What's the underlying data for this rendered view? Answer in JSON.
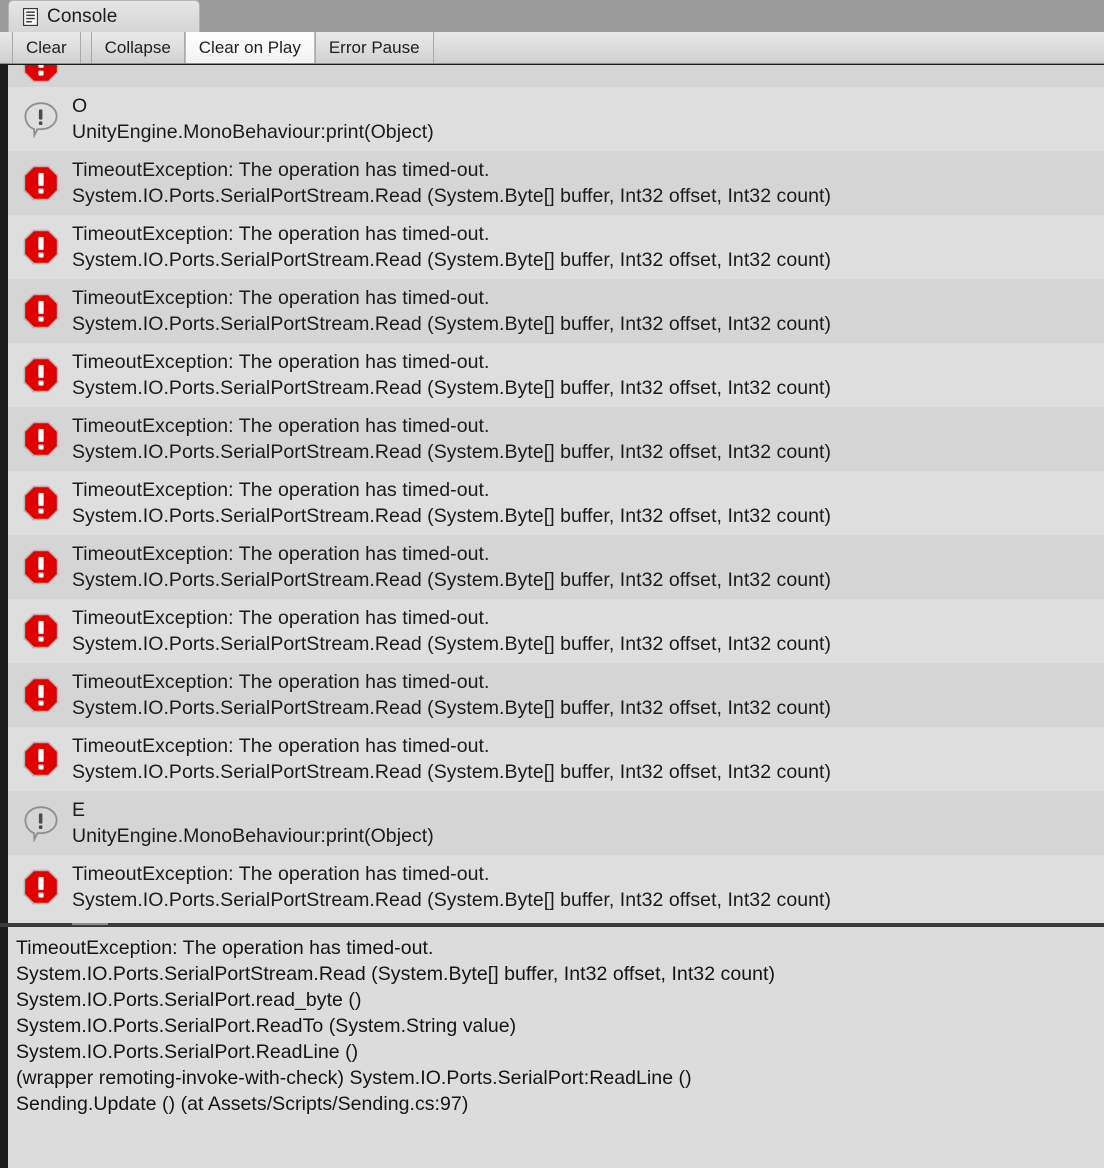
{
  "window": {
    "tab_label": "Console",
    "tab_icon": "console-document-icon"
  },
  "toolbar": {
    "buttons": [
      {
        "label": "Clear",
        "name": "clear-button",
        "active": false
      },
      {
        "label": "Collapse",
        "name": "collapse-button",
        "active": false
      },
      {
        "label": "Clear on Play",
        "name": "clear-on-play-button",
        "active": true
      },
      {
        "label": "Error Pause",
        "name": "error-pause-button",
        "active": false
      }
    ]
  },
  "colors": {
    "error_red": "#e00000",
    "header_gray": "#9b9b9b",
    "row_light": "#dedede",
    "row_dark": "#d5d5d5",
    "text": "#1b1b1b",
    "splitter": "#3b3b3b"
  },
  "log": {
    "error_message": "TimeoutException: The operation has timed-out.",
    "error_stack_line": "System.IO.Ports.SerialPortStream.Read (System.Byte[] buffer, Int32 offset, Int32 count)",
    "print_stack_line": "UnityEngine.MonoBehaviour:print(Object)",
    "entries": [
      {
        "type": "error",
        "clipped": true,
        "icon": "error-octagon-icon",
        "line1": "TimeoutException: The operation has timed-out.",
        "line2": "System.IO.Ports.SerialPortStream.Read (System.Byte[] buffer, Int32 offset, Int32 count)"
      },
      {
        "type": "log",
        "icon": "log-bubble-icon",
        "line1": "O",
        "line2": "UnityEngine.MonoBehaviour:print(Object)"
      },
      {
        "type": "error",
        "icon": "error-octagon-icon",
        "line1": "TimeoutException: The operation has timed-out.",
        "line2": "System.IO.Ports.SerialPortStream.Read (System.Byte[] buffer, Int32 offset, Int32 count)"
      },
      {
        "type": "error",
        "icon": "error-octagon-icon",
        "line1": "TimeoutException: The operation has timed-out.",
        "line2": "System.IO.Ports.SerialPortStream.Read (System.Byte[] buffer, Int32 offset, Int32 count)"
      },
      {
        "type": "error",
        "icon": "error-octagon-icon",
        "line1": "TimeoutException: The operation has timed-out.",
        "line2": "System.IO.Ports.SerialPortStream.Read (System.Byte[] buffer, Int32 offset, Int32 count)"
      },
      {
        "type": "error",
        "icon": "error-octagon-icon",
        "line1": "TimeoutException: The operation has timed-out.",
        "line2": "System.IO.Ports.SerialPortStream.Read (System.Byte[] buffer, Int32 offset, Int32 count)"
      },
      {
        "type": "error",
        "icon": "error-octagon-icon",
        "line1": "TimeoutException: The operation has timed-out.",
        "line2": "System.IO.Ports.SerialPortStream.Read (System.Byte[] buffer, Int32 offset, Int32 count)"
      },
      {
        "type": "error",
        "icon": "error-octagon-icon",
        "line1": "TimeoutException: The operation has timed-out.",
        "line2": "System.IO.Ports.SerialPortStream.Read (System.Byte[] buffer, Int32 offset, Int32 count)"
      },
      {
        "type": "error",
        "icon": "error-octagon-icon",
        "line1": "TimeoutException: The operation has timed-out.",
        "line2": "System.IO.Ports.SerialPortStream.Read (System.Byte[] buffer, Int32 offset, Int32 count)"
      },
      {
        "type": "error",
        "icon": "error-octagon-icon",
        "line1": "TimeoutException: The operation has timed-out.",
        "line2": "System.IO.Ports.SerialPortStream.Read (System.Byte[] buffer, Int32 offset, Int32 count)"
      },
      {
        "type": "error",
        "icon": "error-octagon-icon",
        "line1": "TimeoutException: The operation has timed-out.",
        "line2": "System.IO.Ports.SerialPortStream.Read (System.Byte[] buffer, Int32 offset, Int32 count)"
      },
      {
        "type": "error",
        "icon": "error-octagon-icon",
        "line1": "TimeoutException: The operation has timed-out.",
        "line2": "System.IO.Ports.SerialPortStream.Read (System.Byte[] buffer, Int32 offset, Int32 count)"
      },
      {
        "type": "log",
        "icon": "log-bubble-icon",
        "line1": "E",
        "line2": "UnityEngine.MonoBehaviour:print(Object)"
      },
      {
        "type": "error",
        "icon": "error-octagon-icon",
        "line1": "TimeoutException: The operation has timed-out.",
        "line2": "System.IO.Ports.SerialPortStream.Read (System.Byte[] buffer, Int32 offset, Int32 count)"
      }
    ]
  },
  "detail": {
    "lines": [
      "TimeoutException: The operation has timed-out.",
      "System.IO.Ports.SerialPortStream.Read (System.Byte[] buffer, Int32 offset, Int32 count)",
      "System.IO.Ports.SerialPort.read_byte ()",
      "System.IO.Ports.SerialPort.ReadTo (System.String value)",
      "System.IO.Ports.SerialPort.ReadLine ()",
      "(wrapper remoting-invoke-with-check) System.IO.Ports.SerialPort:ReadLine ()",
      "Sending.Update () (at Assets/Scripts/Sending.cs:97)"
    ]
  }
}
